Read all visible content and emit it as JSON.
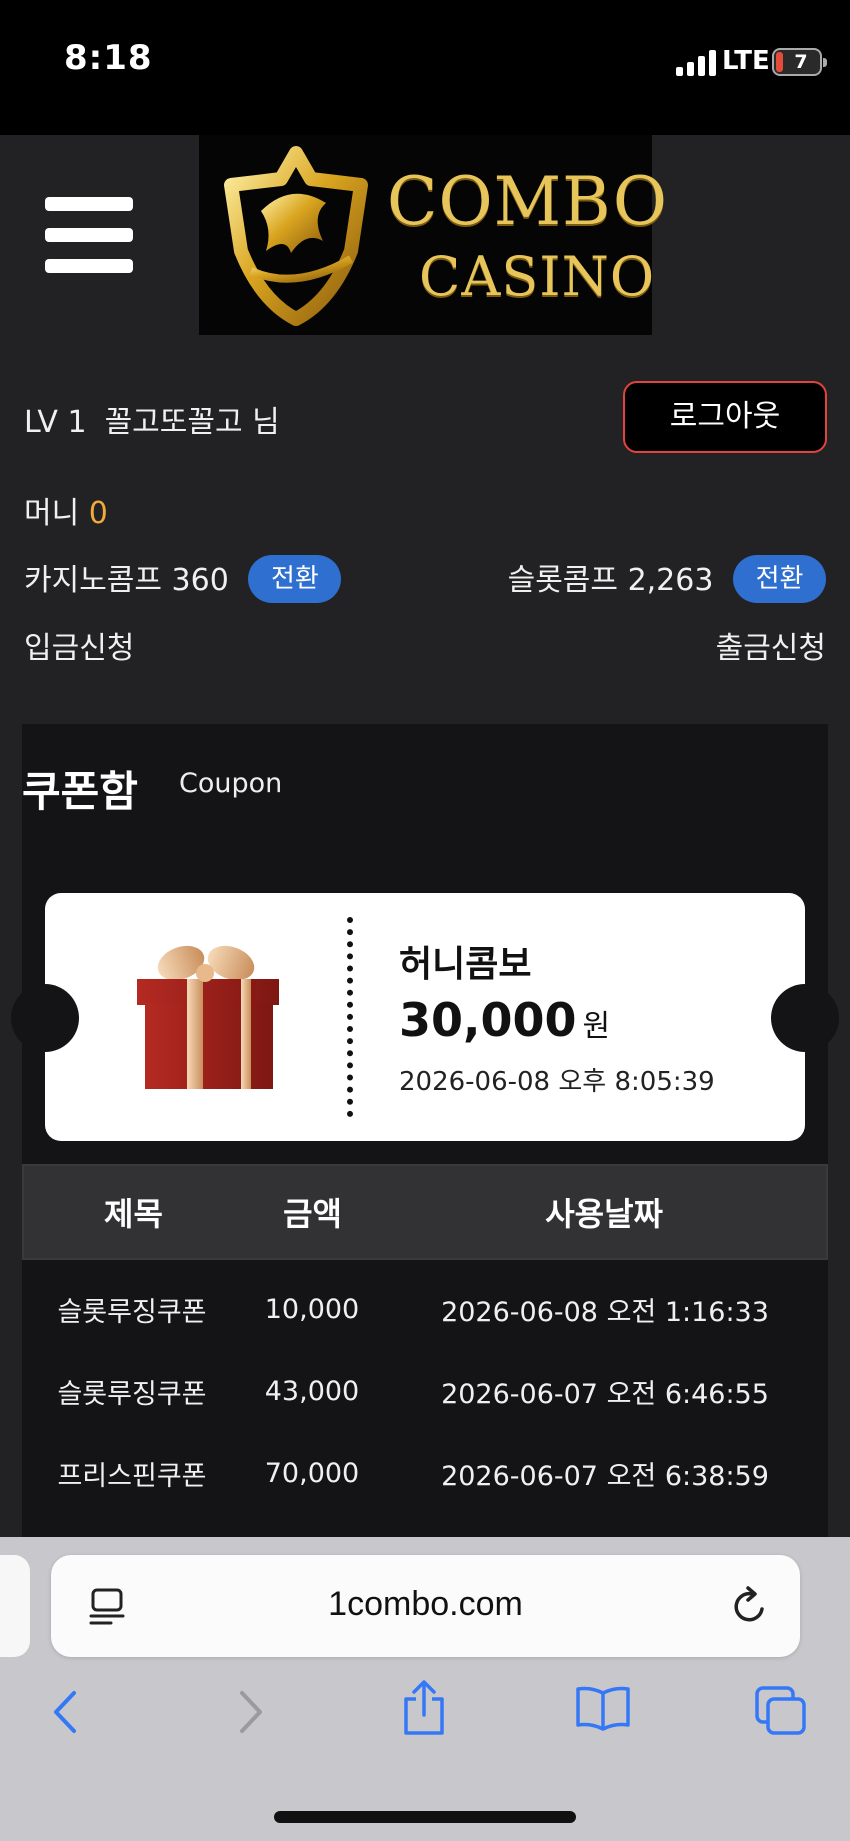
{
  "status_bar": {
    "time": "8:18",
    "network": "LTE",
    "battery": "7"
  },
  "header": {
    "logo_line1": "COMBO",
    "logo_line2": "CASINO"
  },
  "user": {
    "level": "LV 1",
    "nickname": "꼴고또꼴고 님",
    "logout_label": "로그아웃",
    "money_label": "머니",
    "money_value": "0",
    "casino_comp_label": "카지노콤프",
    "casino_comp_value": "360",
    "slot_comp_label": "슬롯콤프",
    "slot_comp_value": "2,263",
    "convert_label": "전환",
    "deposit_label": "입금신청",
    "withdraw_label": "출금신청"
  },
  "coupon": {
    "title": "쿠폰함",
    "subtitle": "Coupon",
    "ticket": {
      "name": "허니콤보",
      "amount": "30,000",
      "unit": "원",
      "date": "2026-06-08 오후 8:05:39"
    },
    "columns": [
      "제목",
      "금액",
      "사용날짜"
    ],
    "rows": [
      {
        "title": "슬롯루징쿠폰",
        "amount": "10,000",
        "date": "2026-06-08 오전 1:16:33"
      },
      {
        "title": "슬롯루징쿠폰",
        "amount": "43,000",
        "date": "2026-06-07 오전 6:46:55"
      },
      {
        "title": "프리스핀쿠폰",
        "amount": "70,000",
        "date": "2026-06-07 오전 6:38:59"
      }
    ]
  },
  "browser": {
    "url": "1combo.com"
  },
  "colors": {
    "accent_blue": "#2f6fd0",
    "logout_border": "#e0443a",
    "money_value": "#f2a83a",
    "ios_blue": "#3478f6"
  }
}
